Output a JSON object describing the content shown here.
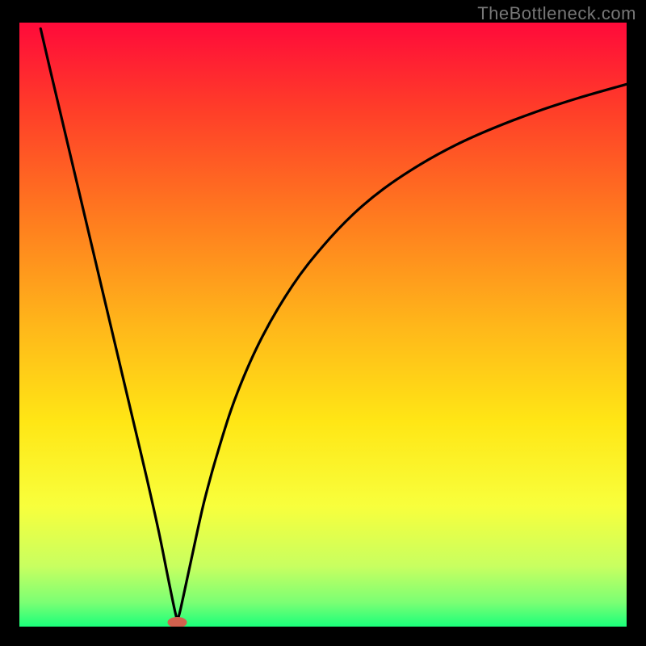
{
  "watermark": "TheBottleneck.com",
  "chart_data": {
    "type": "line",
    "title": "",
    "xlabel": "",
    "ylabel": "",
    "xlim": [
      0,
      100
    ],
    "ylim": [
      0,
      100
    ],
    "grid": false,
    "legend": false,
    "gradient_stops": [
      {
        "offset": 0.0,
        "color": "#ff0a3a"
      },
      {
        "offset": 0.14,
        "color": "#ff3c29"
      },
      {
        "offset": 0.32,
        "color": "#ff7a1f"
      },
      {
        "offset": 0.5,
        "color": "#ffb61a"
      },
      {
        "offset": 0.66,
        "color": "#ffe615"
      },
      {
        "offset": 0.8,
        "color": "#f8ff3c"
      },
      {
        "offset": 0.9,
        "color": "#c8ff60"
      },
      {
        "offset": 0.96,
        "color": "#7bff74"
      },
      {
        "offset": 1.0,
        "color": "#1aff7a"
      }
    ],
    "series": [
      {
        "name": "curve",
        "stroke": "#000000",
        "stroke_width": 3.2,
        "x": [
          3.5,
          5,
          7,
          9,
          11,
          13,
          15,
          17,
          19,
          21,
          23,
          24.5,
          25.8,
          26.2,
          27,
          28.5,
          30.5,
          33,
          36,
          40,
          45,
          50,
          55,
          60,
          66,
          72,
          78,
          85,
          92,
          100
        ],
        "y": [
          99,
          92.5,
          84,
          75.5,
          67,
          58.5,
          50,
          41.5,
          33,
          24.5,
          15.5,
          8,
          1.8,
          1.6,
          5,
          12,
          21,
          30,
          39,
          48,
          56.5,
          63,
          68.3,
          72.5,
          76.5,
          79.8,
          82.5,
          85.2,
          87.5,
          89.8
        ]
      }
    ],
    "marker": {
      "name": "minimum-marker",
      "x": 26,
      "y": 0.7,
      "rx": 1.6,
      "ry": 0.9,
      "color": "#d2614e"
    }
  }
}
